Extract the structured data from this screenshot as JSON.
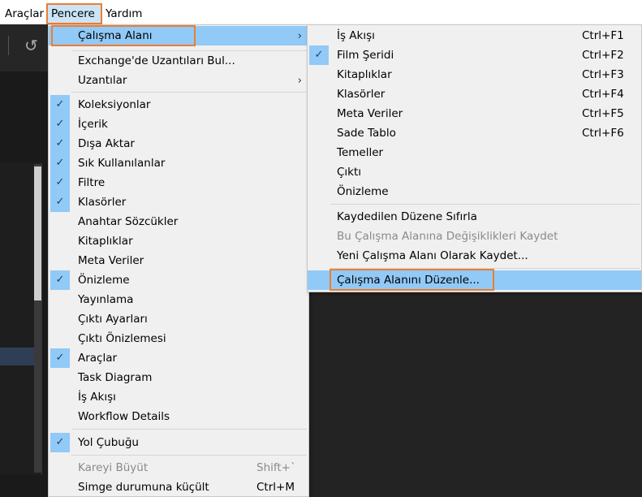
{
  "menubar": {
    "items": [
      "Araçlar",
      "Pencere",
      "Yardım"
    ]
  },
  "colors": {
    "highlight": "#91c9f7",
    "annotation": "#ed7d31"
  },
  "main_menu": {
    "workspace": "Çalışma Alanı",
    "group1": [
      "Exchange'de Uzantıları Bul...",
      "Uzantılar"
    ],
    "panels": [
      {
        "label": "Koleksiyonlar",
        "checked": true
      },
      {
        "label": "İçerik",
        "checked": true
      },
      {
        "label": "Dışa Aktar",
        "checked": true
      },
      {
        "label": "Sık Kullanılanlar",
        "checked": true
      },
      {
        "label": "Filtre",
        "checked": true
      },
      {
        "label": "Klasörler",
        "checked": true
      },
      {
        "label": "Anahtar Sözcükler",
        "checked": false
      },
      {
        "label": "Kitaplıklar",
        "checked": false
      },
      {
        "label": "Meta Veriler",
        "checked": false
      },
      {
        "label": "Önizleme",
        "checked": true
      },
      {
        "label": "Yayınlama",
        "checked": false
      },
      {
        "label": "Çıktı Ayarları",
        "checked": false
      },
      {
        "label": "Çıktı Önizlemesi",
        "checked": false
      },
      {
        "label": "Araçlar",
        "checked": true
      },
      {
        "label": "Task Diagram",
        "checked": false
      },
      {
        "label": "İş Akışı",
        "checked": false
      },
      {
        "label": "Workflow Details",
        "checked": false
      }
    ],
    "path_bar": "Yol Çubuğu",
    "maximize": {
      "label": "Kareyi Büyüt",
      "shortcut": "Shift+`"
    },
    "minimize": {
      "label": "Simge durumuna küçült",
      "shortcut": "Ctrl+M"
    }
  },
  "submenu": {
    "workspaces": [
      {
        "label": "İş Akışı",
        "shortcut": "Ctrl+F1",
        "checked": false
      },
      {
        "label": "Film Şeridi",
        "shortcut": "Ctrl+F2",
        "checked": true
      },
      {
        "label": "Kitaplıklar",
        "shortcut": "Ctrl+F3",
        "checked": false
      },
      {
        "label": "Klasörler",
        "shortcut": "Ctrl+F4",
        "checked": false
      },
      {
        "label": "Meta Veriler",
        "shortcut": "Ctrl+F5",
        "checked": false
      },
      {
        "label": "Sade Tablo",
        "shortcut": "Ctrl+F6",
        "checked": false
      },
      {
        "label": "Temeller",
        "shortcut": "",
        "checked": false
      },
      {
        "label": "Çıktı",
        "shortcut": "",
        "checked": false
      },
      {
        "label": "Önizleme",
        "shortcut": "",
        "checked": false
      }
    ],
    "reset": "Kaydedilen Düzene Sıfırla",
    "save_changes": "Bu Çalışma Alanına Değişiklikleri Kaydet",
    "save_new": "Yeni Çalışma Alanı Olarak Kaydet...",
    "edit": "Çalışma Alanını Düzenle..."
  }
}
